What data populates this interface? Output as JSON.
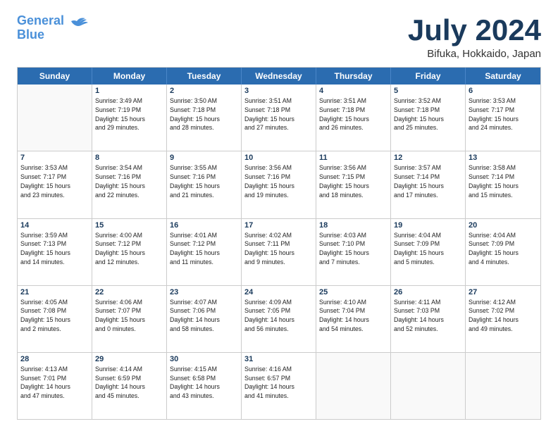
{
  "header": {
    "logo_line1": "General",
    "logo_line2": "Blue",
    "month": "July 2024",
    "location": "Bifuka, Hokkaido, Japan"
  },
  "weekdays": [
    "Sunday",
    "Monday",
    "Tuesday",
    "Wednesday",
    "Thursday",
    "Friday",
    "Saturday"
  ],
  "weeks": [
    [
      {
        "day": "",
        "info": ""
      },
      {
        "day": "1",
        "info": "Sunrise: 3:49 AM\nSunset: 7:19 PM\nDaylight: 15 hours\nand 29 minutes."
      },
      {
        "day": "2",
        "info": "Sunrise: 3:50 AM\nSunset: 7:18 PM\nDaylight: 15 hours\nand 28 minutes."
      },
      {
        "day": "3",
        "info": "Sunrise: 3:51 AM\nSunset: 7:18 PM\nDaylight: 15 hours\nand 27 minutes."
      },
      {
        "day": "4",
        "info": "Sunrise: 3:51 AM\nSunset: 7:18 PM\nDaylight: 15 hours\nand 26 minutes."
      },
      {
        "day": "5",
        "info": "Sunrise: 3:52 AM\nSunset: 7:18 PM\nDaylight: 15 hours\nand 25 minutes."
      },
      {
        "day": "6",
        "info": "Sunrise: 3:53 AM\nSunset: 7:17 PM\nDaylight: 15 hours\nand 24 minutes."
      }
    ],
    [
      {
        "day": "7",
        "info": "Sunrise: 3:53 AM\nSunset: 7:17 PM\nDaylight: 15 hours\nand 23 minutes."
      },
      {
        "day": "8",
        "info": "Sunrise: 3:54 AM\nSunset: 7:16 PM\nDaylight: 15 hours\nand 22 minutes."
      },
      {
        "day": "9",
        "info": "Sunrise: 3:55 AM\nSunset: 7:16 PM\nDaylight: 15 hours\nand 21 minutes."
      },
      {
        "day": "10",
        "info": "Sunrise: 3:56 AM\nSunset: 7:16 PM\nDaylight: 15 hours\nand 19 minutes."
      },
      {
        "day": "11",
        "info": "Sunrise: 3:56 AM\nSunset: 7:15 PM\nDaylight: 15 hours\nand 18 minutes."
      },
      {
        "day": "12",
        "info": "Sunrise: 3:57 AM\nSunset: 7:14 PM\nDaylight: 15 hours\nand 17 minutes."
      },
      {
        "day": "13",
        "info": "Sunrise: 3:58 AM\nSunset: 7:14 PM\nDaylight: 15 hours\nand 15 minutes."
      }
    ],
    [
      {
        "day": "14",
        "info": "Sunrise: 3:59 AM\nSunset: 7:13 PM\nDaylight: 15 hours\nand 14 minutes."
      },
      {
        "day": "15",
        "info": "Sunrise: 4:00 AM\nSunset: 7:12 PM\nDaylight: 15 hours\nand 12 minutes."
      },
      {
        "day": "16",
        "info": "Sunrise: 4:01 AM\nSunset: 7:12 PM\nDaylight: 15 hours\nand 11 minutes."
      },
      {
        "day": "17",
        "info": "Sunrise: 4:02 AM\nSunset: 7:11 PM\nDaylight: 15 hours\nand 9 minutes."
      },
      {
        "day": "18",
        "info": "Sunrise: 4:03 AM\nSunset: 7:10 PM\nDaylight: 15 hours\nand 7 minutes."
      },
      {
        "day": "19",
        "info": "Sunrise: 4:04 AM\nSunset: 7:09 PM\nDaylight: 15 hours\nand 5 minutes."
      },
      {
        "day": "20",
        "info": "Sunrise: 4:04 AM\nSunset: 7:09 PM\nDaylight: 15 hours\nand 4 minutes."
      }
    ],
    [
      {
        "day": "21",
        "info": "Sunrise: 4:05 AM\nSunset: 7:08 PM\nDaylight: 15 hours\nand 2 minutes."
      },
      {
        "day": "22",
        "info": "Sunrise: 4:06 AM\nSunset: 7:07 PM\nDaylight: 15 hours\nand 0 minutes."
      },
      {
        "day": "23",
        "info": "Sunrise: 4:07 AM\nSunset: 7:06 PM\nDaylight: 14 hours\nand 58 minutes."
      },
      {
        "day": "24",
        "info": "Sunrise: 4:09 AM\nSunset: 7:05 PM\nDaylight: 14 hours\nand 56 minutes."
      },
      {
        "day": "25",
        "info": "Sunrise: 4:10 AM\nSunset: 7:04 PM\nDaylight: 14 hours\nand 54 minutes."
      },
      {
        "day": "26",
        "info": "Sunrise: 4:11 AM\nSunset: 7:03 PM\nDaylight: 14 hours\nand 52 minutes."
      },
      {
        "day": "27",
        "info": "Sunrise: 4:12 AM\nSunset: 7:02 PM\nDaylight: 14 hours\nand 49 minutes."
      }
    ],
    [
      {
        "day": "28",
        "info": "Sunrise: 4:13 AM\nSunset: 7:01 PM\nDaylight: 14 hours\nand 47 minutes."
      },
      {
        "day": "29",
        "info": "Sunrise: 4:14 AM\nSunset: 6:59 PM\nDaylight: 14 hours\nand 45 minutes."
      },
      {
        "day": "30",
        "info": "Sunrise: 4:15 AM\nSunset: 6:58 PM\nDaylight: 14 hours\nand 43 minutes."
      },
      {
        "day": "31",
        "info": "Sunrise: 4:16 AM\nSunset: 6:57 PM\nDaylight: 14 hours\nand 41 minutes."
      },
      {
        "day": "",
        "info": ""
      },
      {
        "day": "",
        "info": ""
      },
      {
        "day": "",
        "info": ""
      }
    ]
  ]
}
